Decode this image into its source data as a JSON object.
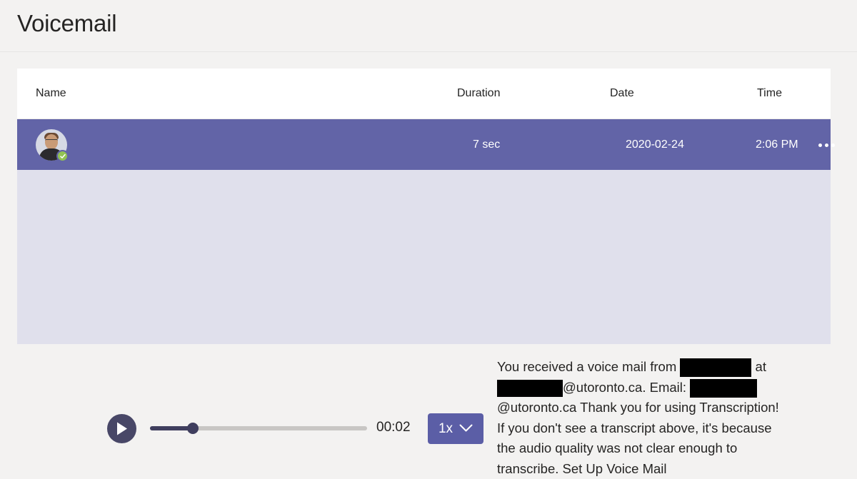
{
  "page": {
    "title": "Voicemail"
  },
  "table": {
    "headers": {
      "name": "Name",
      "duration": "Duration",
      "date": "Date",
      "time": "Time"
    },
    "rows": [
      {
        "name": "[redacted]",
        "name_redacted": true,
        "duration": "7 sec",
        "date": "2020-02-24",
        "time": "2:06 PM",
        "selected": true,
        "presence": "available",
        "overflow_label": "More options"
      }
    ]
  },
  "detail": {
    "player": {
      "play_label": "Play",
      "current_time": "00:02",
      "progress_percent": 20,
      "speed_label": "1x",
      "speed_caret": "chevron-down"
    },
    "transcript": {
      "part1": "You received a voice mail from ",
      "part2": " at ",
      "part3": "@utoronto.ca. Email: ",
      "part4": "@utoronto.ca Thank you for using Transcription! If you don't see a transcript above, it's because the audio quality was not clear enough to transcribe. Set Up Voice Mail",
      "full_text": "You received a voice mail from [redacted] at [redacted]@utoronto.ca. Email: [redacted]@utoronto.ca Thank you for using Transcription! If you don't see a transcript above, it's because the audio quality was not clear enough to transcribe. Set Up Voice Mail"
    }
  },
  "colors": {
    "page_background": "#F3F2F1",
    "card_background": "#FFFFFF",
    "selected_row": "#6264A7",
    "detail_background": "#E0E0EC",
    "play_button": "#484767",
    "scrub_fill": "#3F3E5E",
    "scrub_track": "#C8C6C4",
    "speed_button": "#5B5EA6",
    "presence_available": "#92C353",
    "redaction": "#000000",
    "text_primary": "#252423"
  }
}
